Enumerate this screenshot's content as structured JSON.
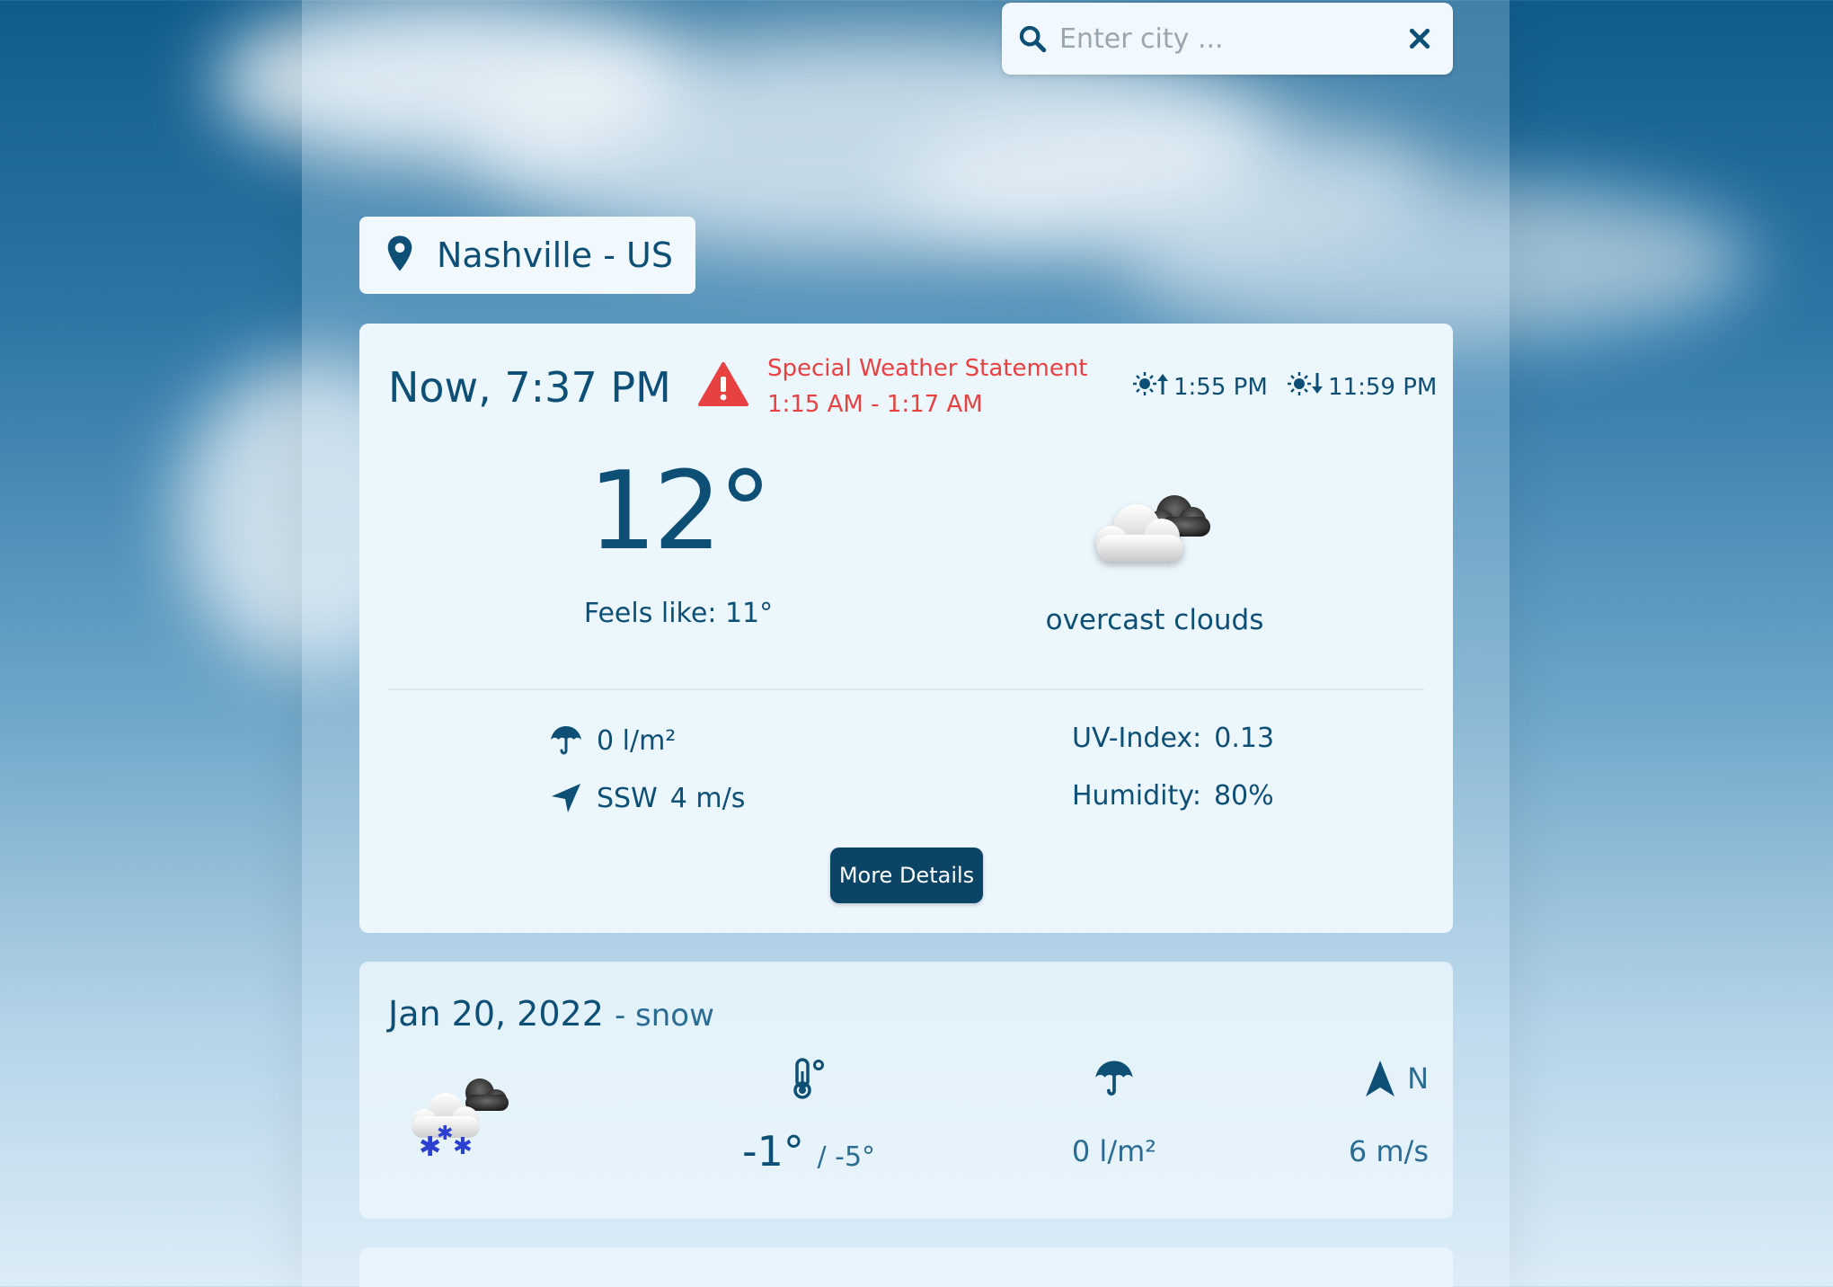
{
  "search": {
    "placeholder": "Enter city ..."
  },
  "location": {
    "name": "Nashville - US"
  },
  "current": {
    "title": "Now, 7:37 PM",
    "alert": {
      "title": "Special Weather Statement",
      "time": "1:15 AM - 1:17 AM"
    },
    "sunrise": "1:55 PM",
    "sunset": "11:59 PM",
    "temperature": "12°",
    "feels_like": "Feels like: 11°",
    "condition": "overcast clouds",
    "precipitation": "0 l/m²",
    "wind_dir": "SSW",
    "wind_speed": "4 m/s",
    "uv_label": "UV-Index:",
    "uv_value": "0.13",
    "humidity_label": "Humidity:",
    "humidity_value": "80%",
    "more_details": "More Details"
  },
  "forecast": [
    {
      "date": "Jan 20, 2022",
      "condition": "- snow",
      "temp_max": "-1°",
      "temp_min": "/ -5°",
      "precipitation": "0 l/m²",
      "wind_dir": "N",
      "wind_speed": "6 m/s"
    }
  ],
  "colors": {
    "primary": "#0d4f75",
    "alert": "#e84141",
    "button": "#0c4466",
    "card": "#ecf6fd"
  },
  "icons": [
    "search-icon",
    "close-icon",
    "location-pin-icon",
    "warning-icon",
    "sunrise-icon",
    "sunset-icon",
    "overcast-clouds-icon",
    "umbrella-icon",
    "navigation-arrow-icon",
    "snow-cloud-icon",
    "thermometer-icon",
    "wind-direction-icon"
  ]
}
